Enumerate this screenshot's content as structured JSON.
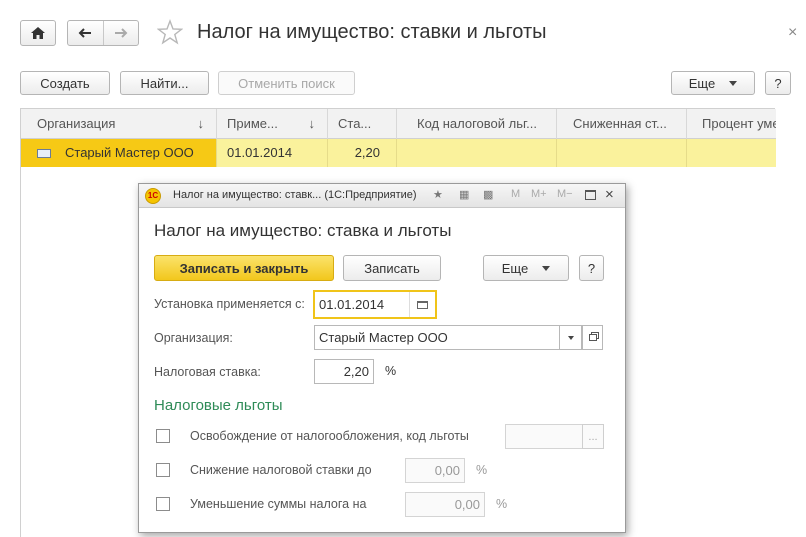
{
  "window": {
    "title": "Налог на имущество: ставки и льготы",
    "close_glyph": "×"
  },
  "toolbar": {
    "create_label": "Создать",
    "find_label": "Найти...",
    "cancel_search_label": "Отменить поиск",
    "more_label": "Еще",
    "help_label": "?"
  },
  "table": {
    "columns": [
      {
        "label": "Организация",
        "sort": "↓"
      },
      {
        "label": "Приме...",
        "sort": "↓"
      },
      {
        "label": "Ста..."
      },
      {
        "label": "Код налоговой льг..."
      },
      {
        "label": "Сниженная ст..."
      },
      {
        "label": "Процент уме"
      }
    ],
    "rows": [
      {
        "organization": "Старый Мастер ООО",
        "date": "01.01.2014",
        "rate": "2,20",
        "code": "",
        "reduced": "",
        "percent": ""
      }
    ]
  },
  "dialog": {
    "window_title": "Налог на имущество: ставк... (1С:Предприятие)",
    "title": "Налог на имущество: ставка и льготы",
    "save_close_label": "Записать и закрыть",
    "save_label": "Записать",
    "more_label": "Еще",
    "help_label": "?",
    "bar_icons": [
      "M",
      "M+",
      "M−"
    ],
    "date_label": "Установка применяется с:",
    "date_value": "01.01.2014",
    "org_label": "Организация:",
    "org_value": "Старый Мастер ООО",
    "rate_label": "Налоговая ставка:",
    "rate_value": "2,20",
    "rate_unit": "%",
    "section_title": "Налоговые льготы",
    "exemption_label": "Освобождение от налогообложения, код льготы",
    "exemption_value": "",
    "exemption_button": "...",
    "reduction_label": "Снижение налоговой ставки до",
    "reduction_value": "0,00",
    "reduction_unit": "%",
    "decrease_label": "Уменьшение суммы налога на",
    "decrease_value": "0,00",
    "decrease_unit": "%"
  },
  "colors": {
    "accent_yellow": "#f6c915",
    "row_highlight": "#faf29c",
    "section_green": "#2e8b57"
  }
}
